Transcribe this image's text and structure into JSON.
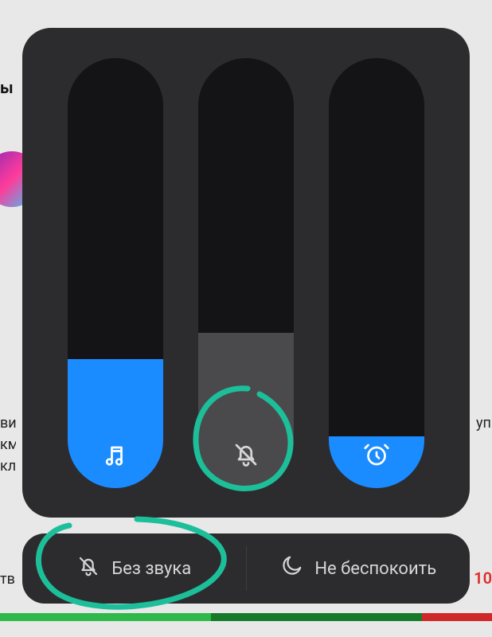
{
  "background": {
    "partial_heading": "ы",
    "left_middle_text": "ви\nкм\nкл",
    "right_middle_text": "уп",
    "left_bottom_label": "тв",
    "right_bottom_label": "10"
  },
  "sliders": {
    "media": {
      "fill_percent": 30,
      "icon": "music-note-icon",
      "color": "#1a8cff"
    },
    "ring": {
      "fill_percent": 36,
      "icon": "bell-mute-icon",
      "color": "#4a4a4c"
    },
    "alarm": {
      "fill_percent": 12,
      "icon": "alarm-clock-icon",
      "color": "#1a8cff"
    }
  },
  "buttons": {
    "mute_label": "Без звука",
    "dnd_label": "Не беспокоить"
  },
  "annotation_color": "#1dbf9a"
}
